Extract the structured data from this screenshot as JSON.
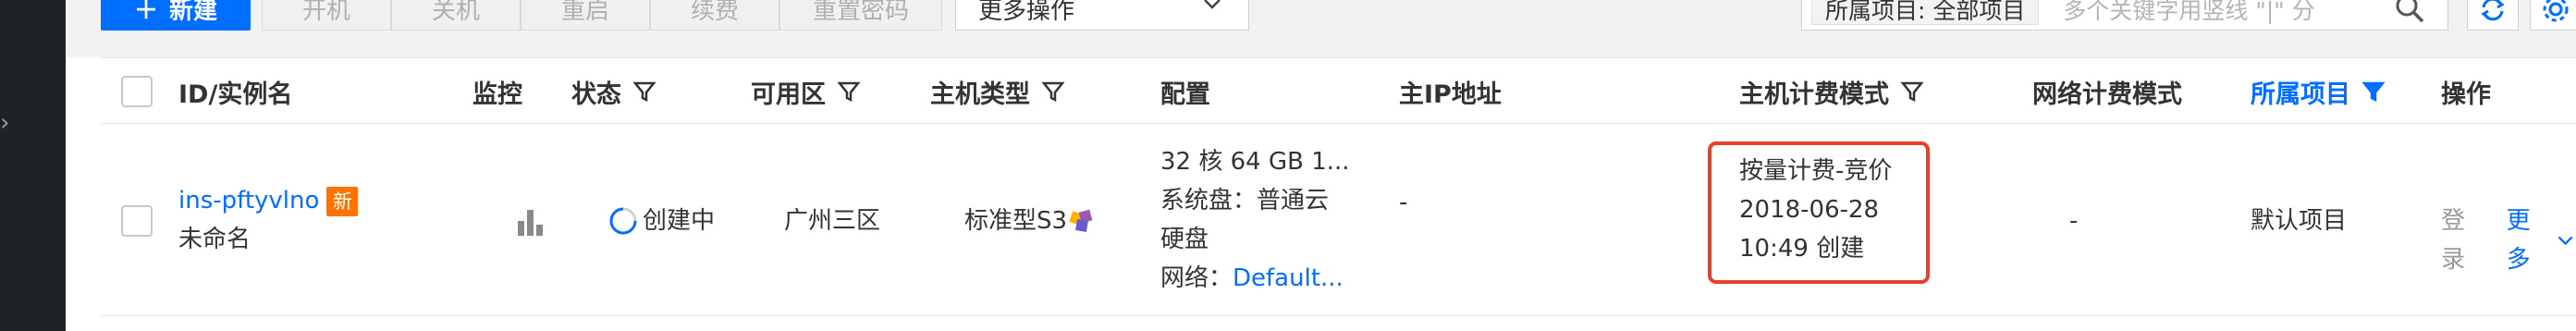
{
  "toolbar": {
    "new_label": "新建",
    "start_label": "开机",
    "shutdown_label": "关机",
    "restart_label": "重启",
    "renew_label": "续费",
    "reset_password_label": "重置密码",
    "more_ops_label": "更多操作"
  },
  "search": {
    "project_tag": "所属项目: 全部项目",
    "placeholder": "多个关键字用竖线 \"|\" 分"
  },
  "table": {
    "headers": {
      "id": "ID/实例名",
      "monitor": "监控",
      "status": "状态",
      "zone": "可用区",
      "type": "主机类型",
      "config": "配置",
      "ip": "主IP地址",
      "billing": "主机计费模式",
      "net_billing": "网络计费模式",
      "project": "所属项目",
      "actions": "操作"
    },
    "row": {
      "instance_id": "ins-pftyvlno",
      "new_badge": "新",
      "instance_name": "未命名",
      "status": "创建中",
      "zone": "广州三区",
      "type": "标准型S3",
      "config_line1": "32 核 64 GB 1...",
      "config_line2": "系统盘：普通云",
      "config_line3": "硬盘",
      "network_label": "网络：",
      "network_value": "Default...",
      "ip": "-",
      "billing_line1": "按量计费-竞价",
      "billing_line2": "2018-06-28",
      "billing_line3": "10:49 创建",
      "net_billing": "-",
      "project": "默认项目",
      "login": "登录",
      "more": "更多"
    }
  },
  "colors": {
    "primary": "#006eff",
    "highlight": "#e8412a",
    "badge": "#ff7200",
    "sidebar": "#1f2227"
  }
}
